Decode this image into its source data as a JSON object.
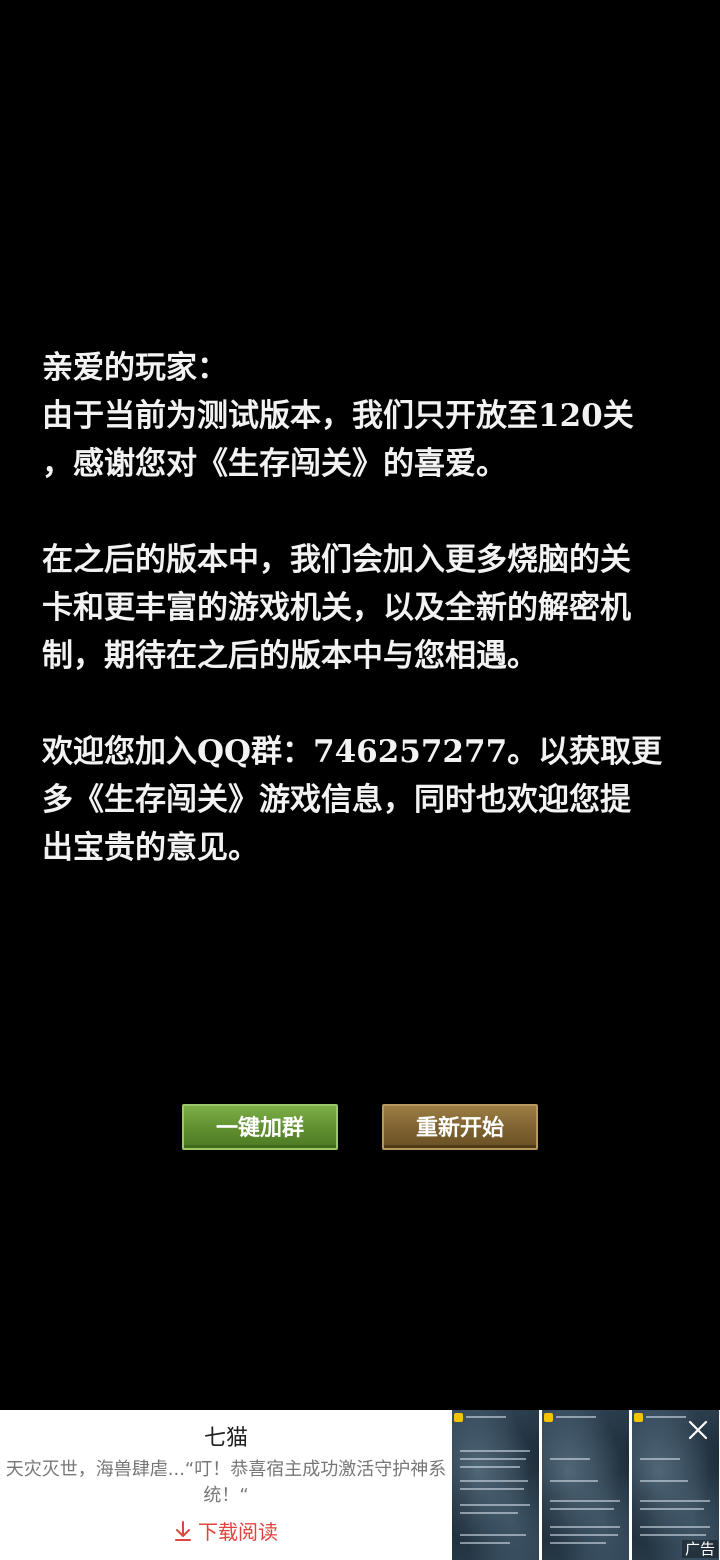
{
  "letter": {
    "greeting": "亲爱的玩家：",
    "para1": [
      "由于当前为测试版本，我们只开放至120关",
      "，感谢您对《生存闯关》的喜爱。"
    ],
    "para2": [
      "在之后的版本中，我们会加入更多烧脑的关",
      "卡和更丰富的游戏机关，以及全新的解密机",
      "制，期待在之后的版本中与您相遇。"
    ],
    "para3": [
      "欢迎您加入QQ群：746257277。以获取更",
      "多《生存闯关》游戏信息，同时也欢迎您提",
      "出宝贵的意见。"
    ]
  },
  "buttons": {
    "join_group": "一键加群",
    "restart": "重新开始"
  },
  "ad": {
    "title": "七猫",
    "description": "天灾灭世，海兽肆虐...“叮！恭喜宿主成功激活守护神系统！“",
    "download": "下载阅读",
    "badge": "广告",
    "close_icon": "close-icon",
    "download_icon": "download-arrow-icon"
  },
  "colors": {
    "background": "#000000",
    "text": "#f2f2f2",
    "join_button": "#6a9a38",
    "restart_button": "#86693a",
    "download_accent": "#e0443e"
  }
}
